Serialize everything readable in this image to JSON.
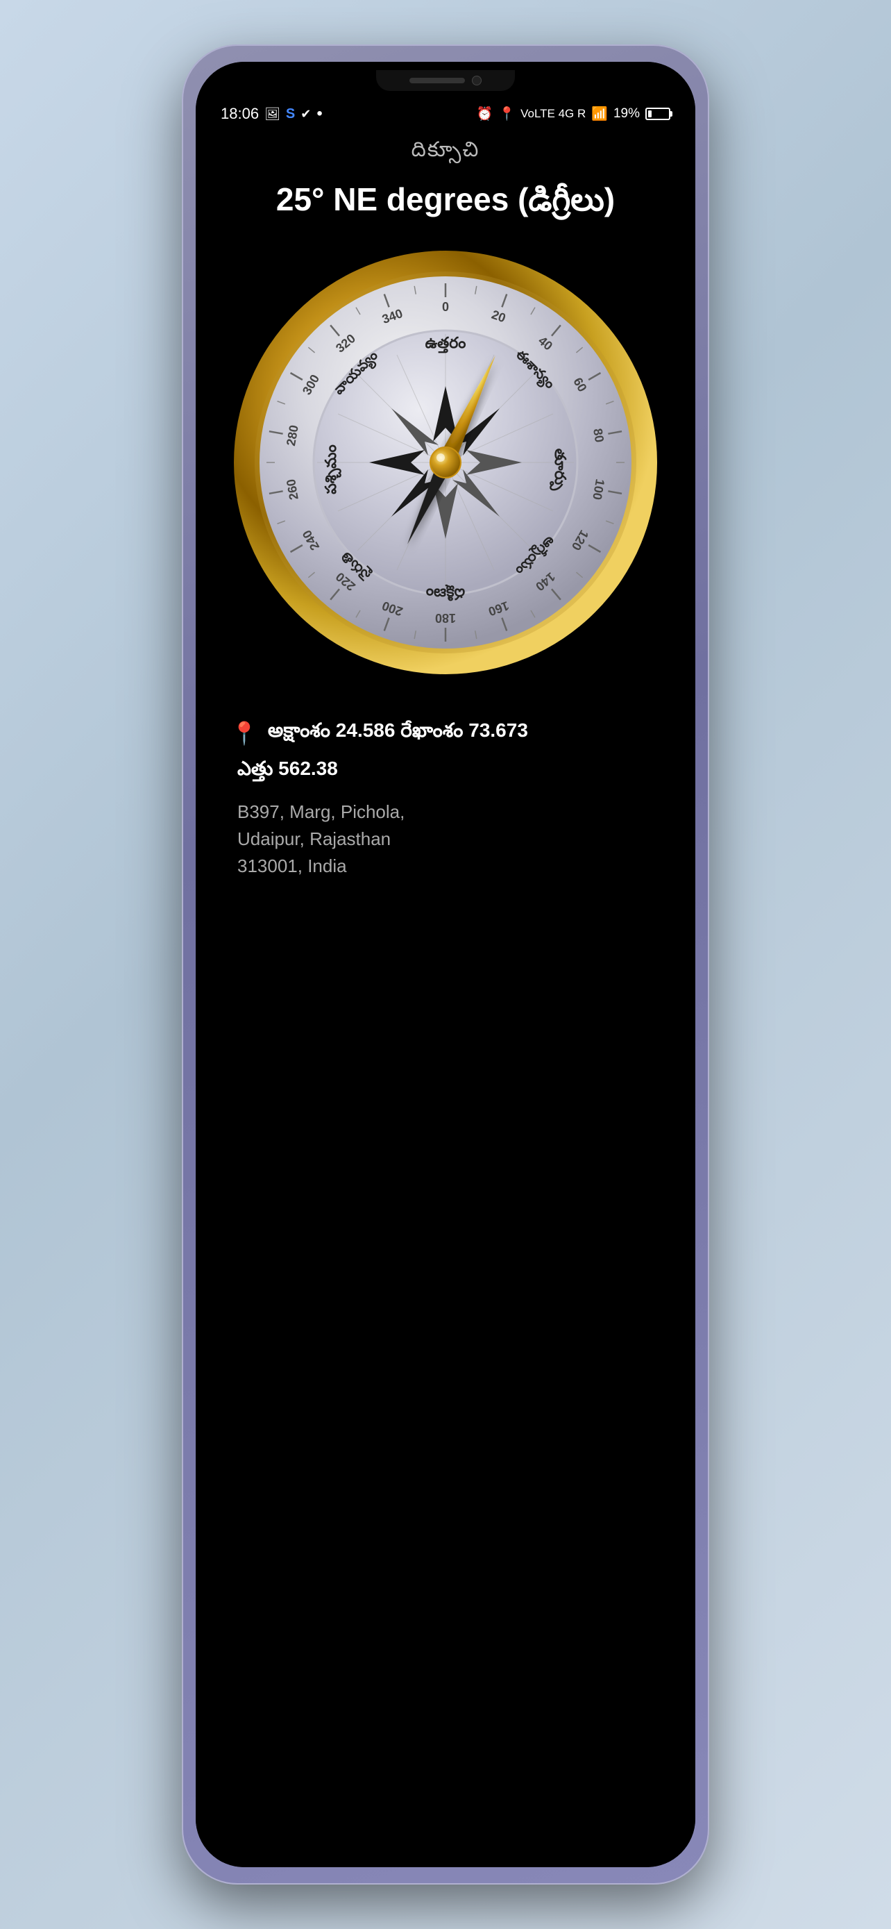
{
  "status": {
    "time": "18:06",
    "battery_percent": "19%",
    "network": "4G",
    "icons": [
      "photo",
      "S",
      "check",
      "dot"
    ]
  },
  "app": {
    "title": "దిక్సూచి",
    "heading": "25° NE degrees (డిగ్రీలు)",
    "compass": {
      "degree": 25,
      "direction": "NE",
      "degree_marks": [
        "0",
        "20",
        "40",
        "60",
        "80",
        "100",
        "120",
        "140",
        "160",
        "180",
        "200",
        "220",
        "240",
        "260",
        "280",
        "300",
        "320",
        "340"
      ],
      "cardinal_labels": {
        "north": "ఉత్తరం",
        "northeast": "ఈశాన్యం",
        "east": "తూర్పు",
        "southeast": "ఆగ్నేయం",
        "south": "దక్షిణం",
        "southwest": "నైరుతి",
        "west": "పశ్చిమం",
        "northwest": "వాయవ్యం"
      }
    },
    "location": {
      "latitude_label": "అక్షాంశం",
      "latitude": "24.586",
      "longitude_label": "రేఖాంశం",
      "longitude": "73.673",
      "elevation_label": "ఎత్తు",
      "elevation": "562.38",
      "address_line1": "B397, Marg, Pichola,",
      "address_line2": "Udaipur, Rajasthan",
      "address_line3": "313001, India"
    }
  }
}
